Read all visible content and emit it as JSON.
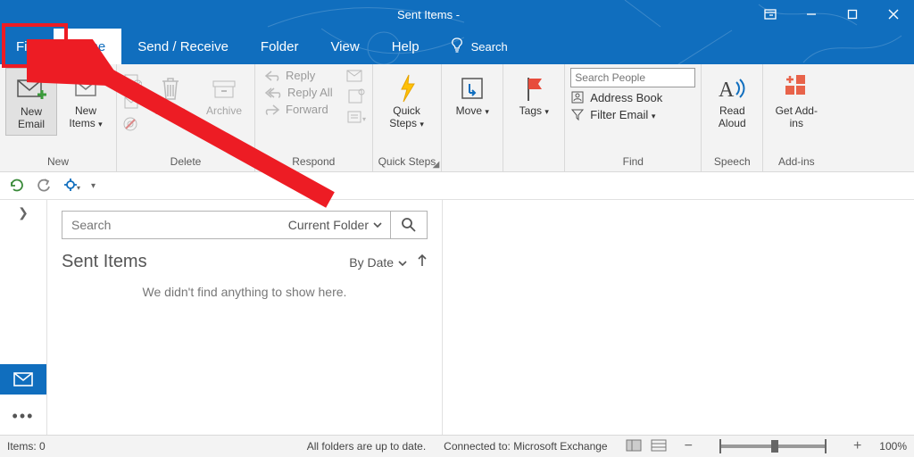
{
  "window": {
    "title": "Sent Items -"
  },
  "menu": {
    "file": "File",
    "home": "Home",
    "sendreceive": "Send / Receive",
    "folder": "Folder",
    "view": "View",
    "help": "Help",
    "search": "Search"
  },
  "ribbon": {
    "new": {
      "new_email": "New Email",
      "new_items": "New Items",
      "group": "New"
    },
    "delete": {
      "delete": "Delete",
      "archive": "Archive",
      "group": "Delete"
    },
    "respond": {
      "reply": "Reply",
      "reply_all": "Reply All",
      "forward": "Forward",
      "group": "Respond"
    },
    "quicksteps": {
      "button": "Quick Steps",
      "group": "Quick Steps"
    },
    "move": {
      "button": "Move",
      "group": ""
    },
    "tags": {
      "button": "Tags",
      "group": ""
    },
    "find": {
      "search_people_placeholder": "Search People",
      "address_book": "Address Book",
      "filter_email": "Filter Email",
      "group": "Find"
    },
    "speech": {
      "button": "Read Aloud",
      "group": "Speech"
    },
    "addins": {
      "button": "Get Add-ins",
      "group": "Add-ins"
    }
  },
  "list": {
    "search_placeholder": "Search",
    "scope": "Current Folder",
    "folder_title": "Sent Items",
    "sort_label": "By Date",
    "empty_message": "We didn't find anything to show here."
  },
  "status": {
    "items": "Items: 0",
    "sync": "All folders are up to date.",
    "connected": "Connected to: Microsoft Exchange",
    "zoom": "100%"
  }
}
